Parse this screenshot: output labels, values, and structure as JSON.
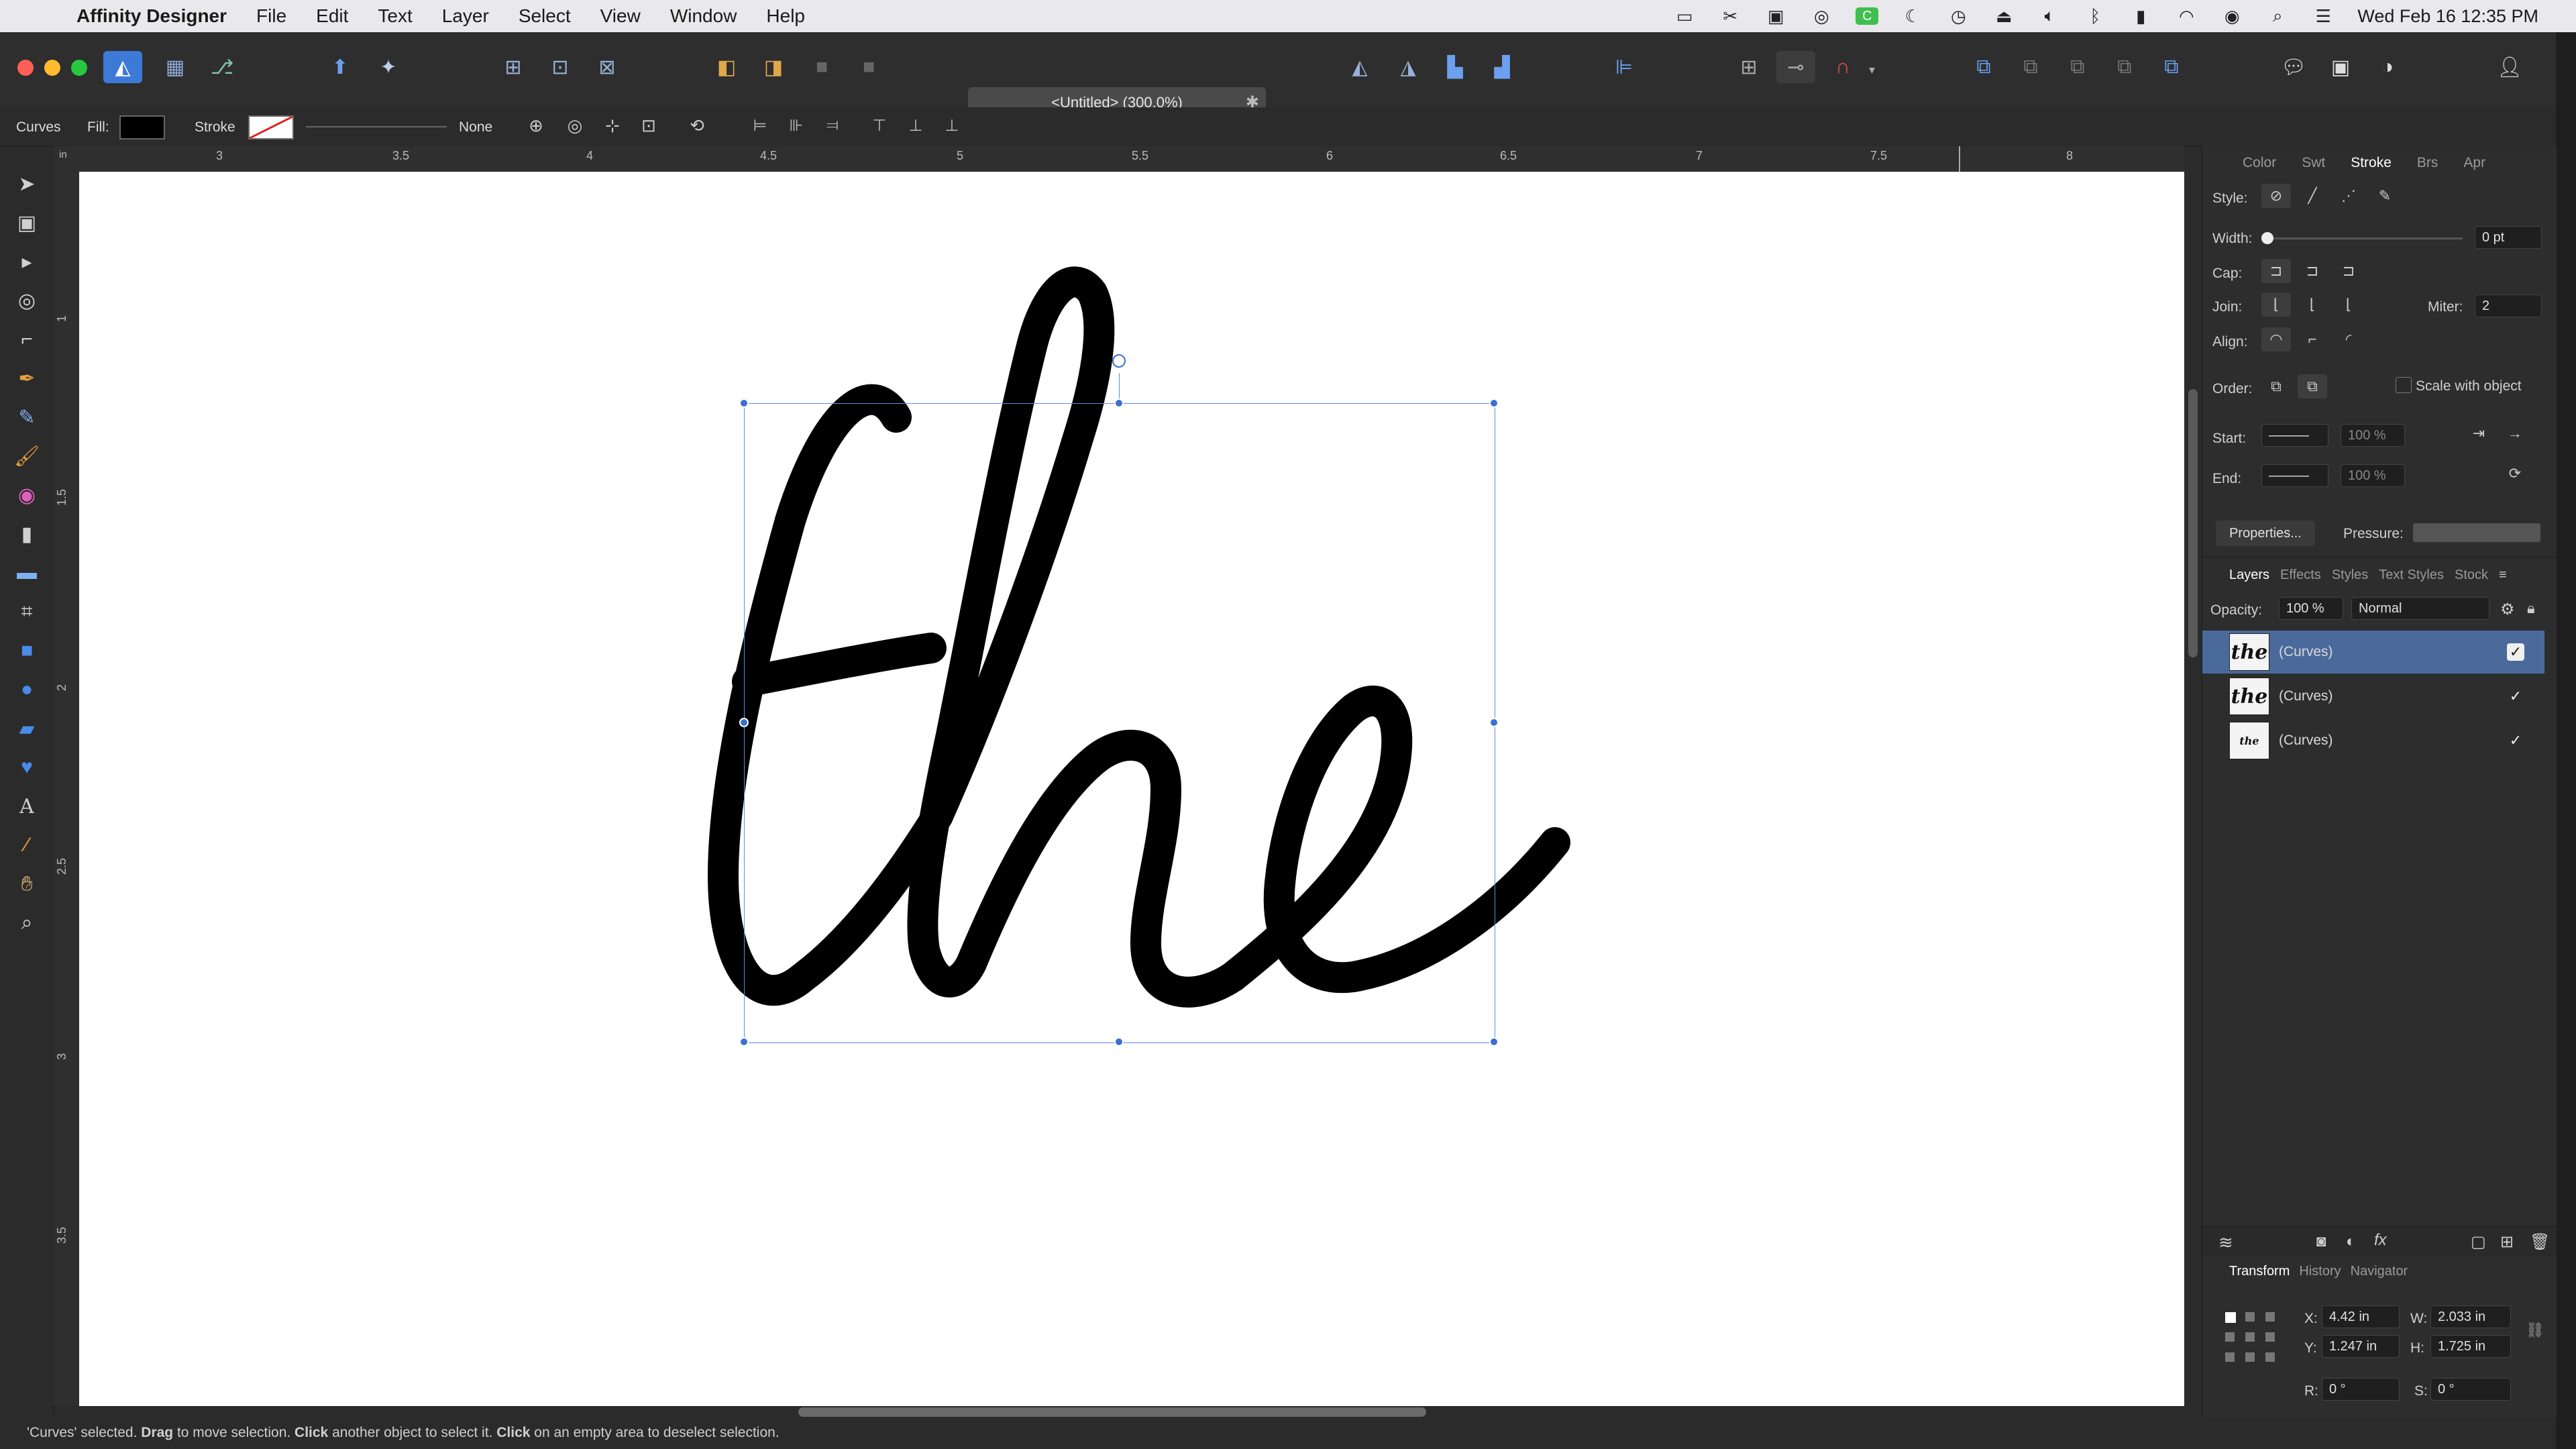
{
  "menubar": {
    "app_name": "Affinity Designer",
    "items": [
      "File",
      "Edit",
      "Text",
      "Layer",
      "Select",
      "View",
      "Window",
      "Help"
    ],
    "clock": "Wed Feb 16  12:35 PM"
  },
  "document": {
    "title": "<Untitled> (300.0%)"
  },
  "context_toolbar": {
    "tool_name": "Curves",
    "fill_label": "Fill:",
    "stroke_label": "Stroke",
    "stroke_style": "None"
  },
  "ruler": {
    "top_ticks": [
      "3",
      "3.5",
      "4",
      "4.5",
      "5",
      "5.5",
      "6",
      "6.5",
      "7",
      "7.5",
      "8"
    ],
    "left_ticks": [
      "1",
      "1.5",
      "2",
      "2.5",
      "3",
      "3.5"
    ],
    "top_unit": "in"
  },
  "canvas": {
    "artwork_text": "the"
  },
  "stroke_panel": {
    "tabs": [
      "Color",
      "Swt",
      "Stroke",
      "Brs",
      "Apr"
    ],
    "active_tab": "Stroke",
    "style_label": "Style:",
    "width_label": "Width:",
    "width_value": "0 pt",
    "cap_label": "Cap:",
    "join_label": "Join:",
    "miter_label": "Miter:",
    "miter_value": "2",
    "align_label": "Align:",
    "order_label": "Order:",
    "scale_with_object": "Scale with object",
    "start_label": "Start:",
    "end_label": "End:",
    "start_pct": "100 %",
    "end_pct": "100 %",
    "properties_button": "Properties...",
    "pressure_label": "Pressure:"
  },
  "layers_panel": {
    "tabs": [
      "Layers",
      "Effects",
      "Styles",
      "Text Styles",
      "Stock"
    ],
    "active_tab": "Layers",
    "opacity_label": "Opacity:",
    "opacity_value": "100 %",
    "blend_mode": "Normal",
    "layers": [
      {
        "name": "(Curves)",
        "selected": true,
        "visible": true
      },
      {
        "name": "(Curves)",
        "selected": false,
        "visible": true
      },
      {
        "name": "(Curves)",
        "selected": false,
        "visible": true
      }
    ]
  },
  "transform_panel": {
    "tabs": [
      "Transform",
      "History",
      "Navigator"
    ],
    "active_tab": "Transform",
    "x_label": "X:",
    "x_value": "4.42 in",
    "y_label": "Y:",
    "y_value": "1.247 in",
    "w_label": "W:",
    "w_value": "2.033 in",
    "h_label": "H:",
    "h_value": "1.725 in",
    "r_label": "R:",
    "r_value": "0 °",
    "s_label": "S:",
    "s_value": "0 °"
  },
  "status": {
    "p1": "'Curves' selected. ",
    "b1": "Drag",
    "p2": " to move selection. ",
    "b2": "Click",
    "p3": " another object to select it. ",
    "b3": "Click",
    "p4": " on an empty area to deselect selection."
  },
  "colors": {
    "accent": "#3b6fd0",
    "selected_layer": "#4a6a9b",
    "fill_swatch": "#000000"
  }
}
